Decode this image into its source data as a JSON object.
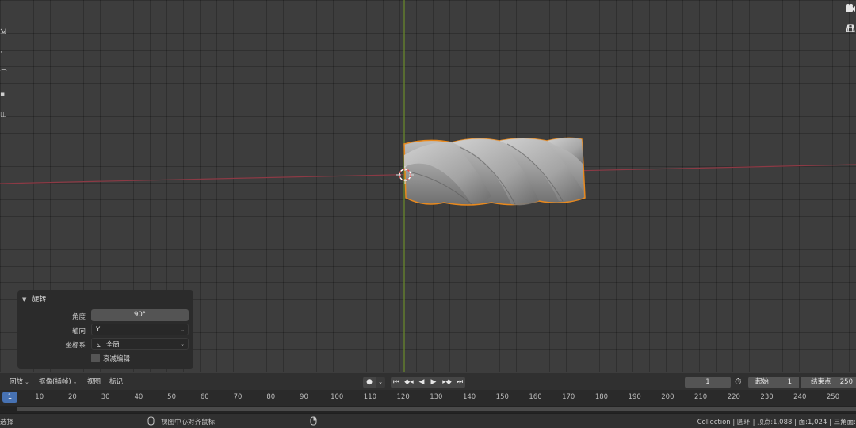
{
  "viewport": {
    "left_toolbar_glyphs": [
      "⇲",
      "·",
      "⌒",
      "▪",
      "◫"
    ],
    "right_gizmo_icons": [
      "camera-icon",
      "grid-icon"
    ],
    "x_axis_color": "#8c3a45",
    "y_axis_color": "#6a8c2a",
    "selection_outline_color": "#e8891e"
  },
  "redo_panel": {
    "title": "旋转",
    "angle_label": "角度",
    "angle_value": "90°",
    "axis_label": "轴向",
    "axis_value": "Y",
    "orient_label": "坐标系",
    "orient_value": "全局",
    "proportional_label": "衰减编辑"
  },
  "timeline": {
    "menus": [
      "回放",
      "抠像(插帧)",
      "视图",
      "标记"
    ],
    "current_frame": "1",
    "start_label": "起始",
    "start_value": "1",
    "end_label": "结束点",
    "end_value": "250",
    "ruler_ticks": [
      "10",
      "20",
      "30",
      "40",
      "50",
      "60",
      "70",
      "80",
      "90",
      "100",
      "110",
      "120",
      "130",
      "140",
      "150",
      "160",
      "170",
      "180",
      "190",
      "200",
      "210",
      "220",
      "230",
      "240",
      "250"
    ],
    "ruler_current": "1"
  },
  "status_bar": {
    "left_text": "选择",
    "mid_text": "视图中心对齐鼠标",
    "right_text": "Collection | 圆环 | 顶点:1,088 | 面:1,024 | 三角面:"
  }
}
